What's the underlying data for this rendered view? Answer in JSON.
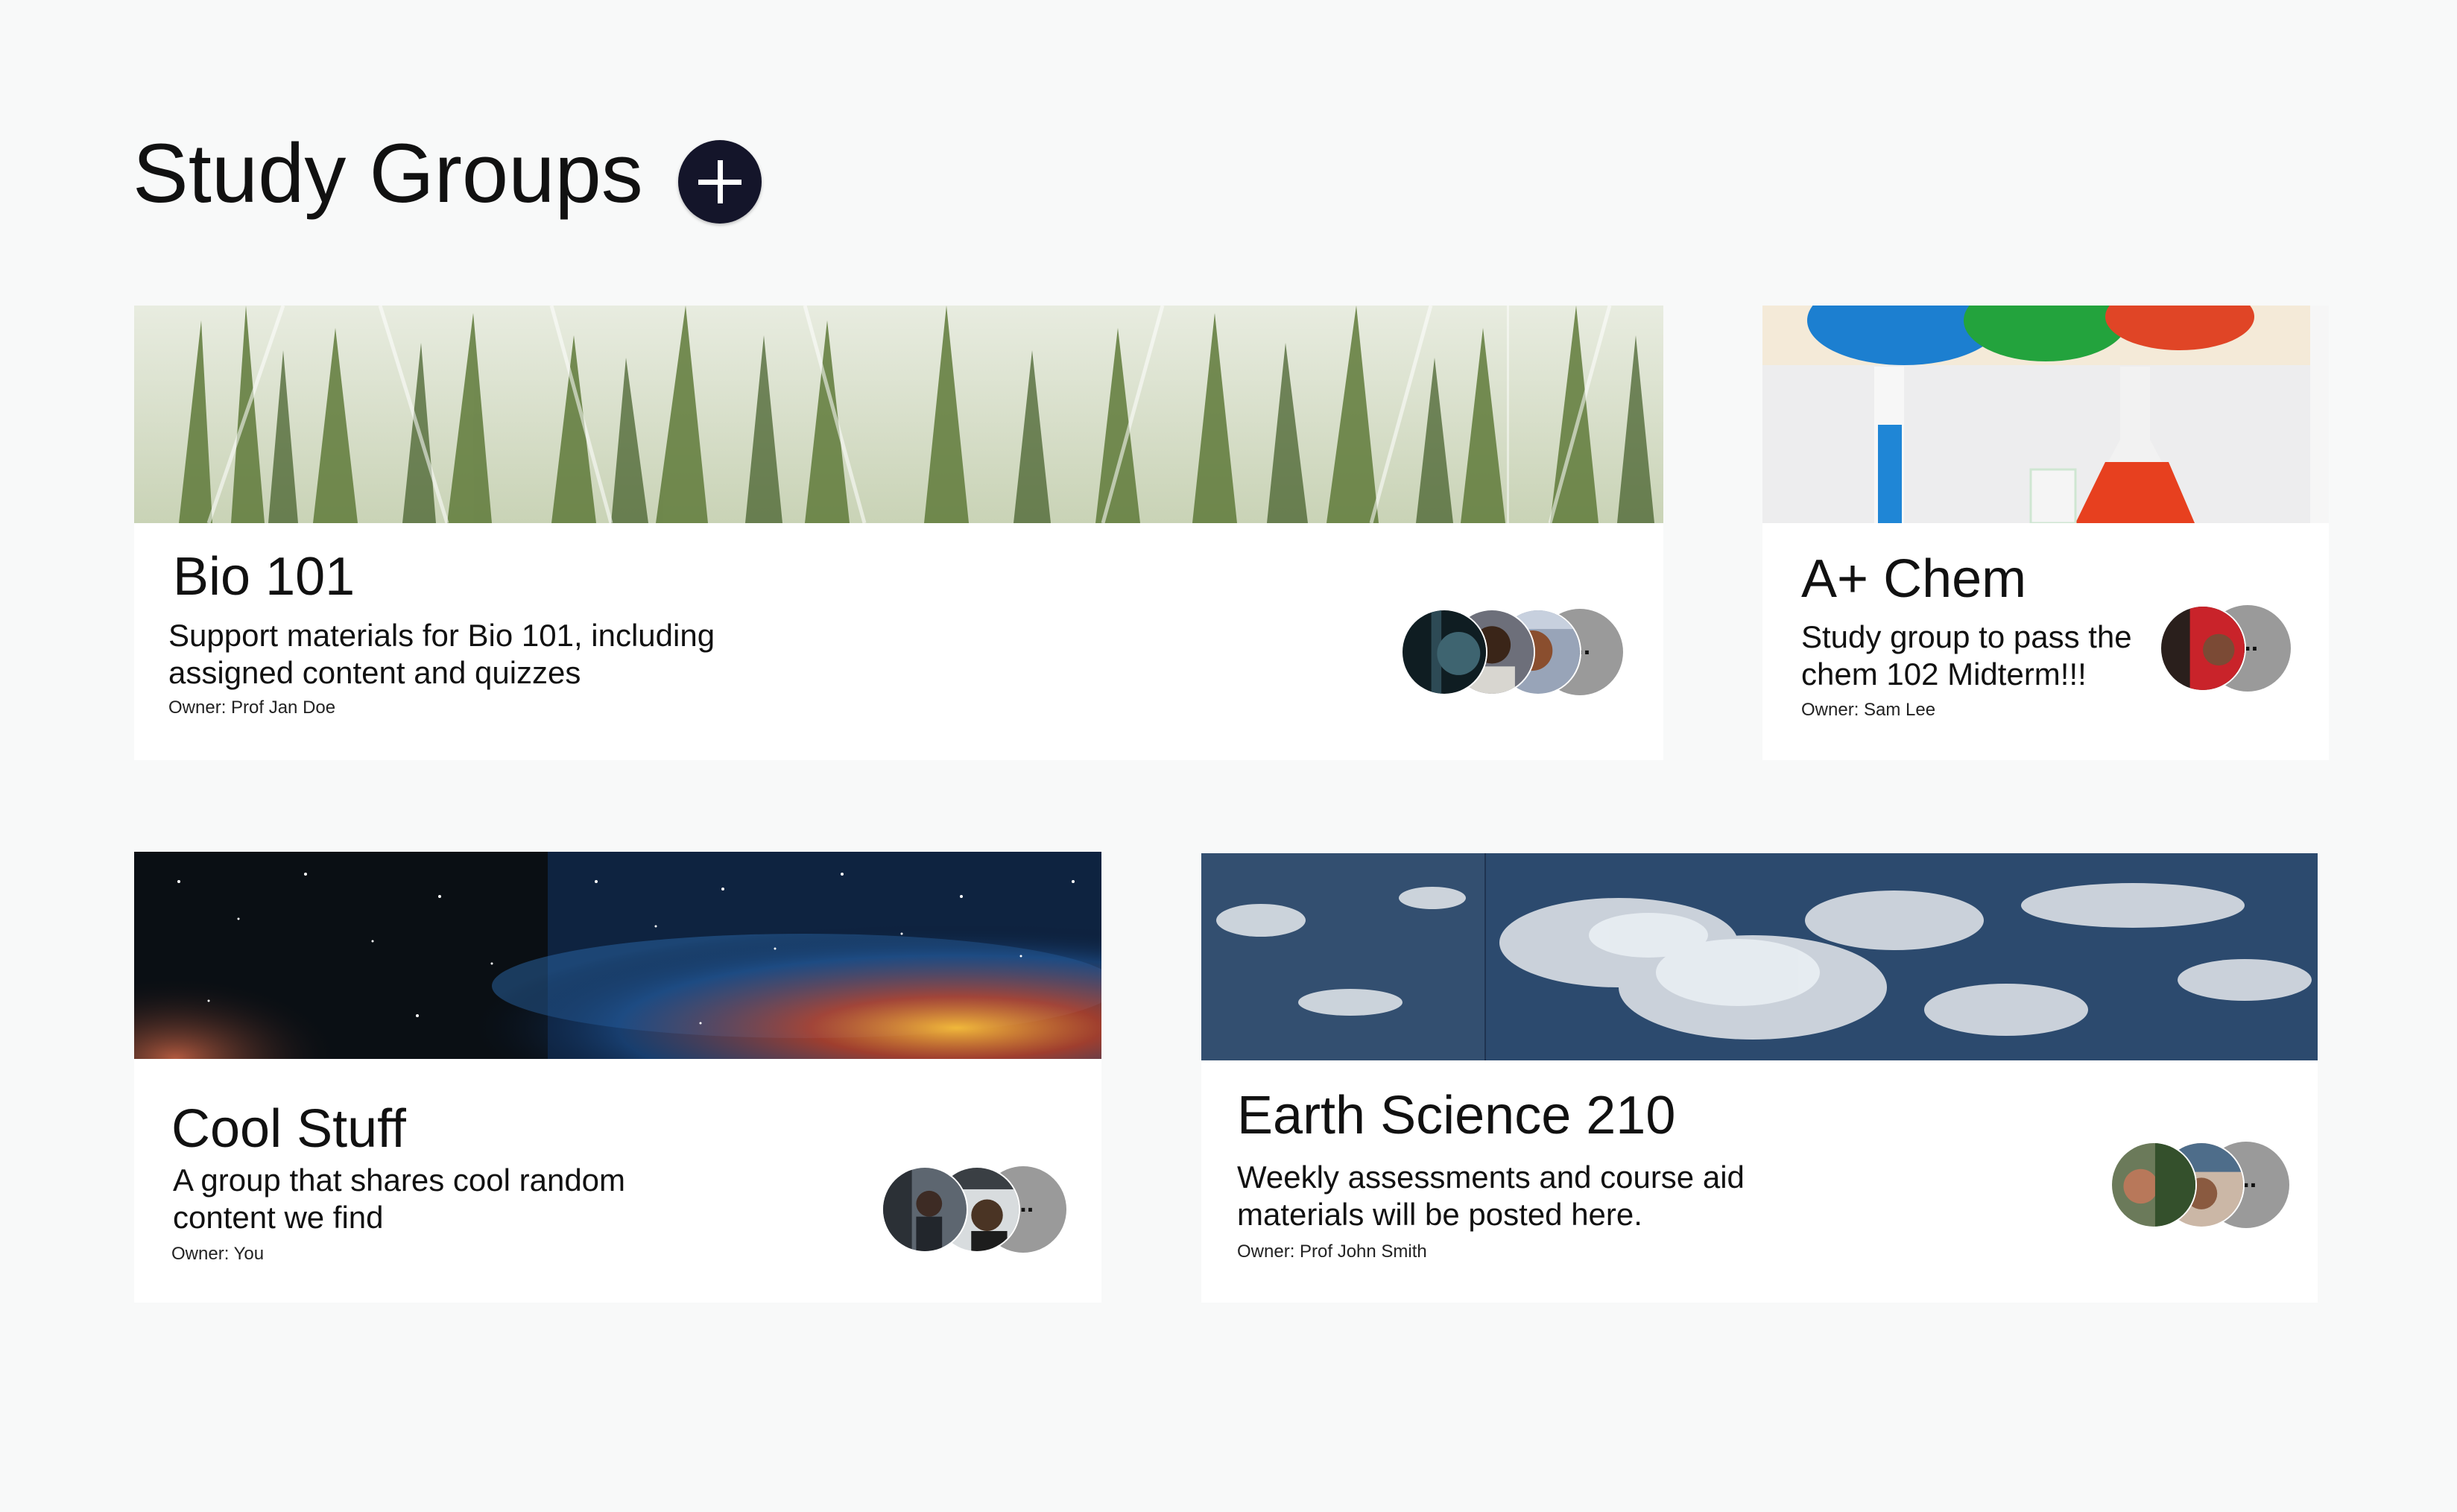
{
  "page": {
    "title": "Study Groups",
    "add_button_icon": "plus-icon"
  },
  "colors": {
    "background": "#f8f9f9",
    "add_button": "#14152a",
    "card": "#ffffff",
    "more_avatar": "#9a9a9a"
  },
  "groups": [
    {
      "name": "Bio 101",
      "description": "Support materials for Bio 101, including assigned content and quizzes",
      "owner": "Owner: Prof Jan Doe",
      "banner": "flasks-with-plants",
      "more_label": "..."
    },
    {
      "name": "A+ Chem",
      "description": "Study group to pass the chem 102 Midterm!!!",
      "owner": "Owner: Sam Lee",
      "banner": "colored-chemistry-flasks",
      "more_label": "..."
    },
    {
      "name": "Cool Stuff",
      "description": "A group that shares cool random content we find",
      "owner": "Owner: You",
      "banner": "starry-night-sky",
      "more_label": "..."
    },
    {
      "name": "Earth Science 210",
      "description": "Weekly assessments and course aid materials will be posted here.",
      "owner": "Owner: Prof John Smith",
      "banner": "earth-clouds-from-space",
      "more_label": "..."
    }
  ]
}
